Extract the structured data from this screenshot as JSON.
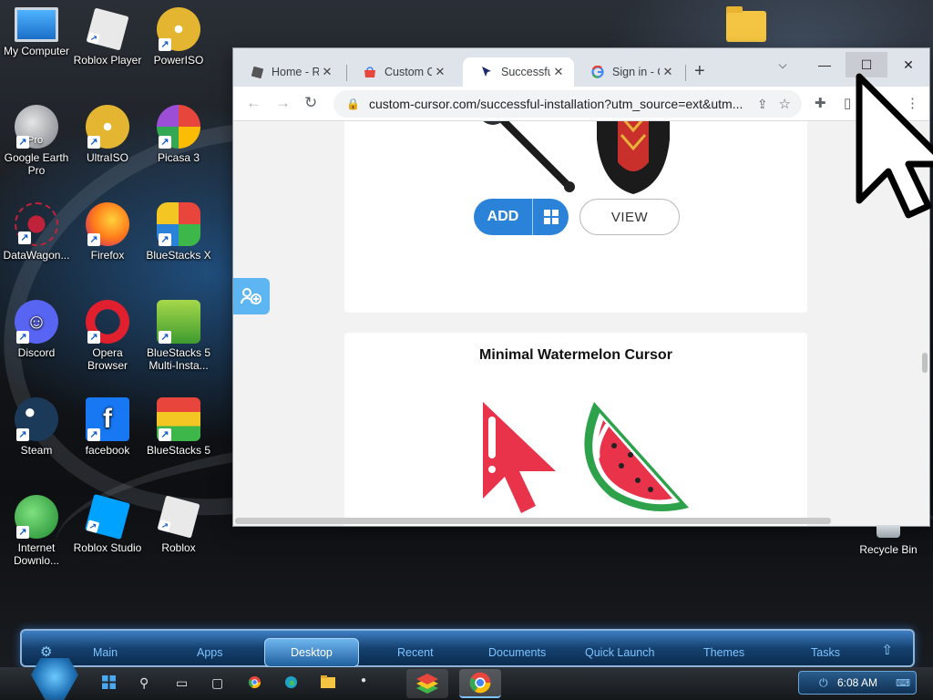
{
  "desktop": {
    "icons": [
      {
        "label": "My Computer",
        "icon": "monitor-icon"
      },
      {
        "label": "Roblox Player",
        "icon": "roblox-icon"
      },
      {
        "label": "PowerISO",
        "icon": "disc-icon"
      },
      {
        "label": "Google Earth Pro",
        "icon": "globe-icon",
        "badge": "Pro"
      },
      {
        "label": "UltraISO",
        "icon": "disc-icon"
      },
      {
        "label": "Picasa 3",
        "icon": "picasa-icon"
      },
      {
        "label": "DataWagon...",
        "icon": "datawagon-icon"
      },
      {
        "label": "Firefox",
        "icon": "firefox-icon"
      },
      {
        "label": "BlueStacks X",
        "icon": "bluestacks-x-icon"
      },
      {
        "label": "Discord",
        "icon": "discord-icon"
      },
      {
        "label": "Opera Browser",
        "icon": "opera-icon"
      },
      {
        "label": "BlueStacks 5 Multi-Insta...",
        "icon": "bluestacks-multi-icon"
      },
      {
        "label": "Steam",
        "icon": "steam-icon"
      },
      {
        "label": "facebook",
        "icon": "facebook-icon"
      },
      {
        "label": "BlueStacks 5",
        "icon": "bluestacks-icon"
      },
      {
        "label": "Internet Downlo...",
        "icon": "idm-icon"
      },
      {
        "label": "Roblox Studio",
        "icon": "roblox-studio-icon"
      },
      {
        "label": "Roblox",
        "icon": "roblox-icon"
      }
    ],
    "recycle_bin": "Recycle Bin"
  },
  "browser": {
    "tabs": [
      {
        "label": "Home - Ro",
        "icon": "roblox-favicon"
      },
      {
        "label": "Custom Cu",
        "icon": "chrome-store-favicon"
      },
      {
        "label": "Successful",
        "icon": "cursor-favicon"
      },
      {
        "label": "Sign in - G",
        "icon": "google-favicon"
      }
    ],
    "active_tab": 2,
    "url": "custom-cursor.com/successful-installation?utm_source=ext&utm...",
    "window_controls": {
      "minimize": "—",
      "maximize": "☐",
      "close": "✕"
    }
  },
  "page": {
    "card1": {
      "add_label": "ADD",
      "view_label": "VIEW"
    },
    "card2": {
      "title": "Minimal Watermelon Cursor"
    }
  },
  "dock": {
    "items": [
      "Main",
      "Apps",
      "Desktop",
      "Recent",
      "Documents",
      "Quick Launch",
      "Themes",
      "Tasks"
    ],
    "active": "Desktop"
  },
  "taskbar": {
    "time": "6:08 AM"
  },
  "colors": {
    "accent": "#2a83d8",
    "dock_text": "#7ec3ff",
    "watermelon_red": "#e8334a",
    "watermelon_green": "#2ea24a"
  }
}
